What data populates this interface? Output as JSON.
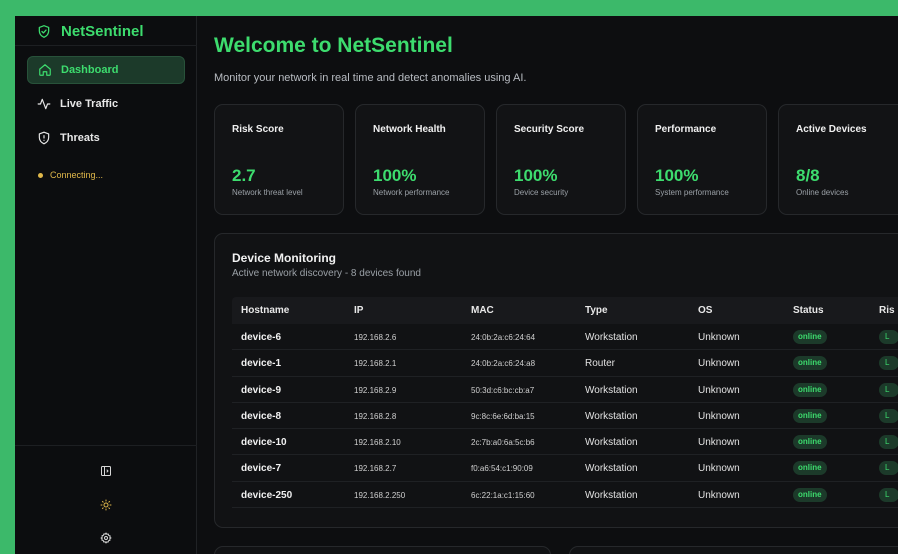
{
  "brand": {
    "name": "NetSentinel"
  },
  "nav": [
    {
      "label": "Dashboard",
      "icon": "home-icon"
    },
    {
      "label": "Live Traffic",
      "icon": "activity-icon"
    },
    {
      "label": "Threats",
      "icon": "shield-alert-icon"
    }
  ],
  "connection": {
    "status": "Connecting..."
  },
  "header": {
    "title": "Welcome to NetSentinel",
    "subtitle": "Monitor your network in real time and detect anomalies using AI."
  },
  "cards": [
    {
      "label": "Risk Score",
      "value": "2.7",
      "desc": "Network threat level"
    },
    {
      "label": "Network Health",
      "value": "100%",
      "desc": "Network performance"
    },
    {
      "label": "Security Score",
      "value": "100%",
      "desc": "Device security"
    },
    {
      "label": "Performance",
      "value": "100%",
      "desc": "System performance"
    },
    {
      "label": "Active Devices",
      "value": "8/8",
      "desc": "Online devices"
    }
  ],
  "devices": {
    "title": "Device Monitoring",
    "subtitle": "Active network discovery - 8 devices found",
    "columns": [
      "Hostname",
      "IP",
      "MAC",
      "Type",
      "OS",
      "Status",
      "Ris"
    ],
    "rows": [
      {
        "host": "device-6",
        "ip": "192.168.2.6",
        "mac": "24:0b:2a:c6:24:64",
        "type": "Workstation",
        "os": "Unknown",
        "status": "online",
        "risk": "L"
      },
      {
        "host": "device-1",
        "ip": "192.168.2.1",
        "mac": "24:0b:2a:c6:24:a8",
        "type": "Router",
        "os": "Unknown",
        "status": "online",
        "risk": "L"
      },
      {
        "host": "device-9",
        "ip": "192.168.2.9",
        "mac": "50:3d:c6:bc:cb:a7",
        "type": "Workstation",
        "os": "Unknown",
        "status": "online",
        "risk": "L"
      },
      {
        "host": "device-8",
        "ip": "192.168.2.8",
        "mac": "9c:8c:6e:6d:ba:15",
        "type": "Workstation",
        "os": "Unknown",
        "status": "online",
        "risk": "L"
      },
      {
        "host": "device-10",
        "ip": "192.168.2.10",
        "mac": "2c:7b:a0:6a:5c:b6",
        "type": "Workstation",
        "os": "Unknown",
        "status": "online",
        "risk": "L"
      },
      {
        "host": "device-7",
        "ip": "192.168.2.7",
        "mac": "f0:a6:54:c1:90:09",
        "type": "Workstation",
        "os": "Unknown",
        "status": "online",
        "risk": "L"
      },
      {
        "host": "device-250",
        "ip": "192.168.2.250",
        "mac": "6c:22:1a:c1:15:60",
        "type": "Workstation",
        "os": "Unknown",
        "status": "online",
        "risk": "L"
      }
    ]
  },
  "sidebar_bottom": [
    {
      "icon": "sidebar-toggle-icon"
    },
    {
      "icon": "sun-icon"
    },
    {
      "icon": "gear-icon"
    }
  ],
  "colors": {
    "accent": "#3ddc6e",
    "warning": "#e0b84a",
    "background": "#0d0e10",
    "frame": "#3cb96a"
  }
}
